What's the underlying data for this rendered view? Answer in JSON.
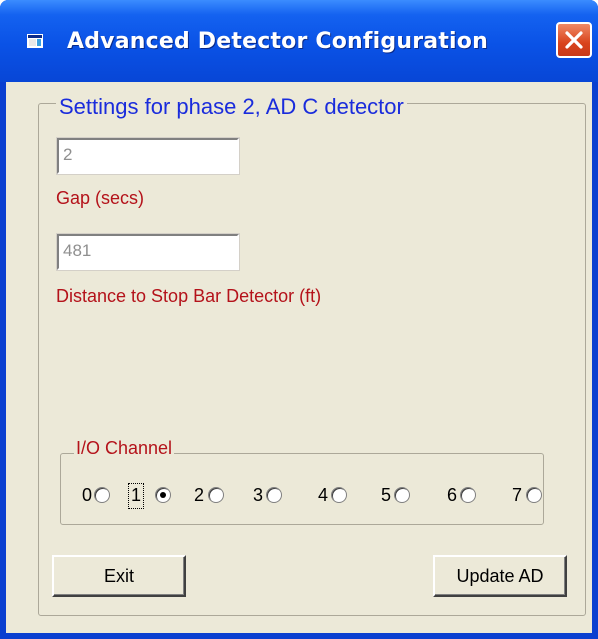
{
  "window": {
    "title": "Advanced Detector Configuration"
  },
  "settings": {
    "group_title": "Settings for phase 2, AD C detector",
    "gap": {
      "value": "2",
      "label": "Gap (secs)"
    },
    "distance": {
      "value": "481",
      "label": "Distance to Stop Bar Detector (ft)"
    }
  },
  "io_channel": {
    "title": "I/O Channel",
    "options": [
      "0",
      "1",
      "2",
      "3",
      "4",
      "5",
      "6",
      "7"
    ],
    "selected": "1"
  },
  "buttons": {
    "exit_label": "Exit",
    "update_label": "Update AD"
  },
  "colors": {
    "title_bar": "#0a52e6",
    "group_title_text": "#1a2cdc",
    "label_text": "#b4121a",
    "dialog_background": "#ece9d8"
  },
  "icons": {
    "app": "app-window-icon",
    "close": "close-icon"
  }
}
